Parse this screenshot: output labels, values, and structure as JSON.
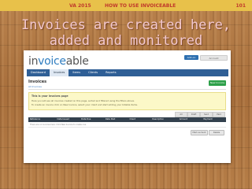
{
  "header": {
    "left": "VA 2015",
    "title": "HOW TO USE INVOICEABLE",
    "slide_number": "101"
  },
  "headline": {
    "line1": "Invoices are created  here,",
    "line2": "added and monitored"
  },
  "app": {
    "logo_prefix": "in",
    "logo_accent": "voice",
    "logo_suffix": "able",
    "user_buttons": [
      "Add-on",
      "Account"
    ],
    "nav": [
      "Dashboard",
      "Invoices",
      "Items",
      "Clients",
      "Reports"
    ],
    "page_title": "Invoices",
    "breadcrumb": "All Invoices",
    "new_button": "New Invoice",
    "notice": {
      "title": "This is your invoices page",
      "line1": "Here you will see all invoices created on this page, sorted and filtered using the filters above.",
      "line2": "To create an invoice click on New Invoice, select your client and start adding your billable items."
    },
    "filters": [
      "All",
      "Draft",
      "Sent",
      "Paid"
    ],
    "table_headers": [
      "Reference",
      "Date Issued",
      "Date Due",
      "Date Paid",
      "Client",
      "Description",
      "Amount",
      "Payment"
    ],
    "empty_row": "There are no invoices here. Click New Invoice to create one.",
    "bottom_buttons": [
      "Mark as Sent",
      "Delete"
    ]
  },
  "colors": {
    "topbar": "#e8c14a",
    "headline": "#f2c8cf",
    "nav": "#2f5f96",
    "brand": "#2f7dc0"
  }
}
